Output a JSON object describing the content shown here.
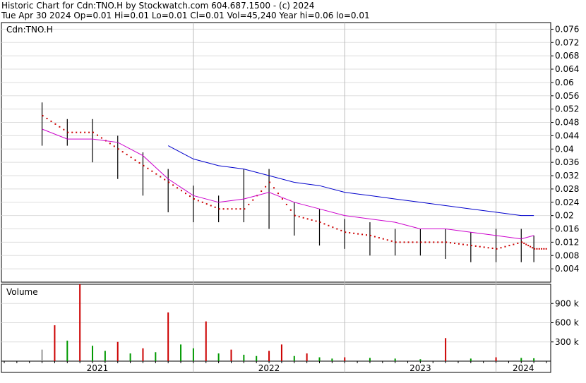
{
  "header": {
    "line1": "Historic Chart for Cdn:TNO.H by Stockwatch.com 604.687.1500 - (c) 2024",
    "line2": "Tue Apr 30 2024  Op=0.01  Hi=0.01  Lo=0.01  Cl=0.01  Vol=45,240  Year hi=0.06  lo=0.01"
  },
  "chart_data": [
    {
      "type": "line",
      "title": "Cdn:TNO.H",
      "x": [
        "2021-01",
        "2021-03",
        "2021-05",
        "2021-07",
        "2021-09",
        "2021-11",
        "2022-01",
        "2022-03",
        "2022-05",
        "2022-07",
        "2022-09",
        "2022-11",
        "2023-01",
        "2023-03",
        "2023-05",
        "2023-07",
        "2023-09",
        "2023-11",
        "2024-01",
        "2024-03",
        "2024-04"
      ],
      "series": [
        {
          "values": [
            0.05,
            0.045,
            0.045,
            0.04,
            0.035,
            0.03,
            0.025,
            0.022,
            0.022,
            0.03,
            0.02,
            0.018,
            0.015,
            0.014,
            0.012,
            0.012,
            0.012,
            0.011,
            0.01,
            0.012,
            0.01
          ]
        },
        {
          "values": [
            0.046,
            0.043,
            0.043,
            0.042,
            0.038,
            0.031,
            0.026,
            0.024,
            0.025,
            0.027,
            0.024,
            0.022,
            0.02,
            0.019,
            0.018,
            0.016,
            0.016,
            0.015,
            0.014,
            0.013,
            0.014
          ]
        },
        {
          "values": [
            null,
            null,
            null,
            null,
            null,
            0.041,
            0.037,
            0.035,
            0.034,
            0.032,
            0.03,
            0.029,
            0.027,
            0.026,
            0.025,
            0.024,
            0.023,
            0.022,
            0.021,
            0.02,
            0.02
          ]
        }
      ],
      "ylim": [
        0.0,
        0.078
      ],
      "yticks": [
        "0.076",
        "0.072",
        "0.068",
        "0.064",
        "0.06",
        "0.056",
        "0.052",
        "0.048",
        "0.044",
        "0.04",
        "0.036",
        "0.032",
        "0.028",
        "0.024",
        "0.02",
        "0.016",
        "0.012",
        "0.008",
        "0.004"
      ],
      "xlabels": [
        "2021",
        "2022",
        "2023",
        "2024"
      ],
      "grid": true,
      "colors": {
        "price": "#000000",
        "dots": "#cc0000",
        "ma_short": "#cc00cc",
        "ma_long": "#0000cc"
      }
    },
    {
      "type": "bar",
      "title": "Volume",
      "yticks": [
        "900 k",
        "600 k",
        "300 k"
      ],
      "ylim": [
        0,
        1200
      ],
      "x": [
        "2021-01",
        "2021-02",
        "2021-03",
        "2021-04",
        "2021-05",
        "2021-06",
        "2021-07",
        "2021-08",
        "2021-09",
        "2021-10",
        "2021-11",
        "2021-12",
        "2022-01",
        "2022-02",
        "2022-03",
        "2022-04",
        "2022-05",
        "2022-06",
        "2022-07",
        "2022-08",
        "2022-09",
        "2022-10",
        "2022-11",
        "2022-12",
        "2023-01",
        "2023-03",
        "2023-05",
        "2023-07",
        "2023-09",
        "2023-11",
        "2024-01",
        "2024-03",
        "2024-04"
      ],
      "series": [
        {
          "values": [
            180,
            560,
            320,
            1200,
            240,
            160,
            300,
            120,
            200,
            140,
            760,
            260,
            200,
            620,
            120,
            180,
            100,
            80,
            160,
            260,
            80,
            120,
            60,
            40,
            60,
            50,
            40,
            30,
            360,
            40,
            60,
            50,
            45
          ]
        }
      ],
      "colors": {
        "up": "#cc0000",
        "down": "#009900",
        "flat": "#999999"
      }
    }
  ]
}
